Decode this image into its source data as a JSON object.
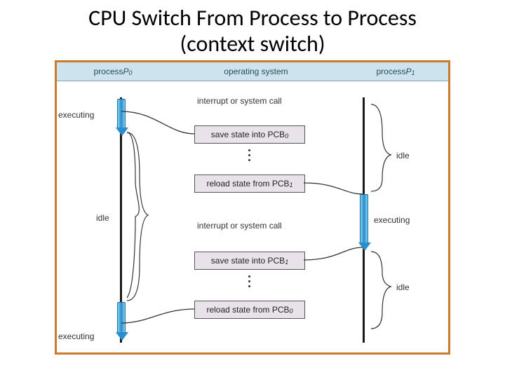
{
  "title_line1": "CPU Switch From Process to Process",
  "title_line2": "(context switch)",
  "header": {
    "p0_prefix": "process ",
    "p0_var": "P",
    "p0_sub": "0",
    "os": "operating system",
    "p1_prefix": "process ",
    "p1_var": "P",
    "p1_sub": "1"
  },
  "labels": {
    "executing": "executing",
    "idle": "idle",
    "interrupt": "interrupt or system call",
    "save_pcb0": "save state into PCB",
    "save_pcb0_sub": "0",
    "reload_pcb1": "reload state from PCB",
    "reload_pcb1_sub": "1",
    "save_pcb1": "save state into PCB",
    "save_pcb1_sub": "1",
    "reload_pcb0": "reload state from PCB",
    "reload_pcb0_sub": "0"
  }
}
